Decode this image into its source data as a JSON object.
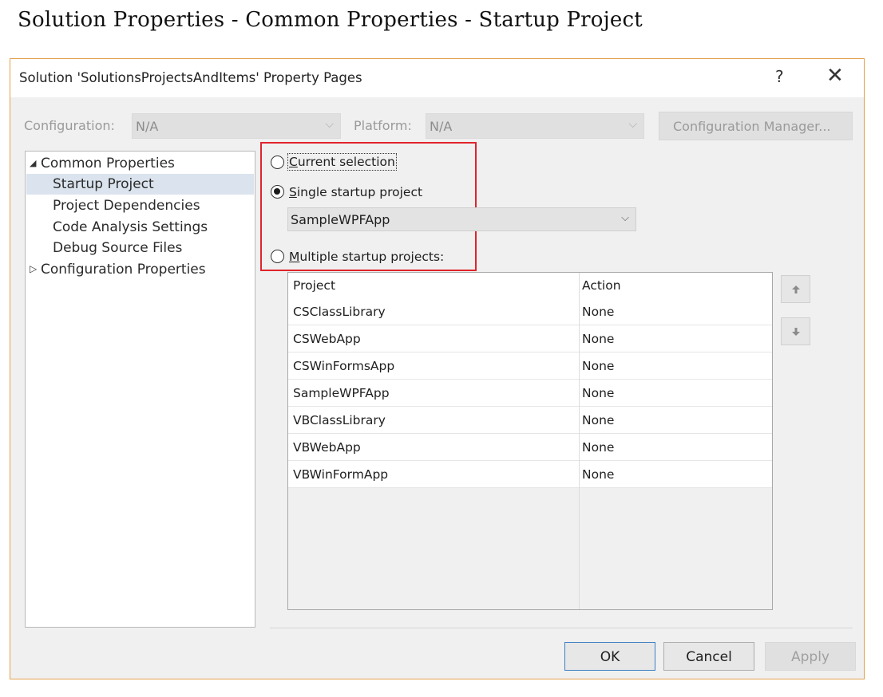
{
  "caption": "Solution Properties - Common Properties - Startup Project",
  "window": {
    "title": "Solution 'SolutionsProjectsAndItems' Property Pages",
    "help": "?",
    "close": "✕"
  },
  "toolbar": {
    "configuration_label": "Configuration:",
    "configuration_value": "N/A",
    "platform_label": "Platform:",
    "platform_value": "N/A",
    "config_manager_label": "Configuration Manager..."
  },
  "tree": {
    "items": [
      {
        "label": "Common Properties",
        "expanded": true
      },
      {
        "label": "Startup Project",
        "selected": true
      },
      {
        "label": "Project Dependencies"
      },
      {
        "label": "Code Analysis Settings"
      },
      {
        "label": "Debug Source Files"
      },
      {
        "label": "Configuration Properties",
        "expanded": false
      }
    ]
  },
  "startup": {
    "current_selection_acc": "C",
    "current_selection_rest": "urrent selection",
    "single_acc": "S",
    "single_rest": "ingle startup project",
    "single_value": "SampleWPFApp",
    "multiple_acc": "M",
    "multiple_rest": "ultiple startup projects:",
    "selected_option": "single"
  },
  "grid": {
    "headers": [
      "Project",
      "Action"
    ],
    "rows": [
      [
        "CSClassLibrary",
        "None"
      ],
      [
        "CSWebApp",
        "None"
      ],
      [
        "CSWinFormsApp",
        "None"
      ],
      [
        "SampleWPFApp",
        "None"
      ],
      [
        "VBClassLibrary",
        "None"
      ],
      [
        "VBWebApp",
        "None"
      ],
      [
        "VBWinFormApp",
        "None"
      ]
    ]
  },
  "buttons": {
    "ok": "OK",
    "cancel": "Cancel",
    "apply": "Apply"
  },
  "colors": {
    "highlight_box": "#e0242c",
    "window_border": "#e3a24b",
    "selection": "#dbe4ee",
    "ok_border": "#3c7fc1"
  }
}
